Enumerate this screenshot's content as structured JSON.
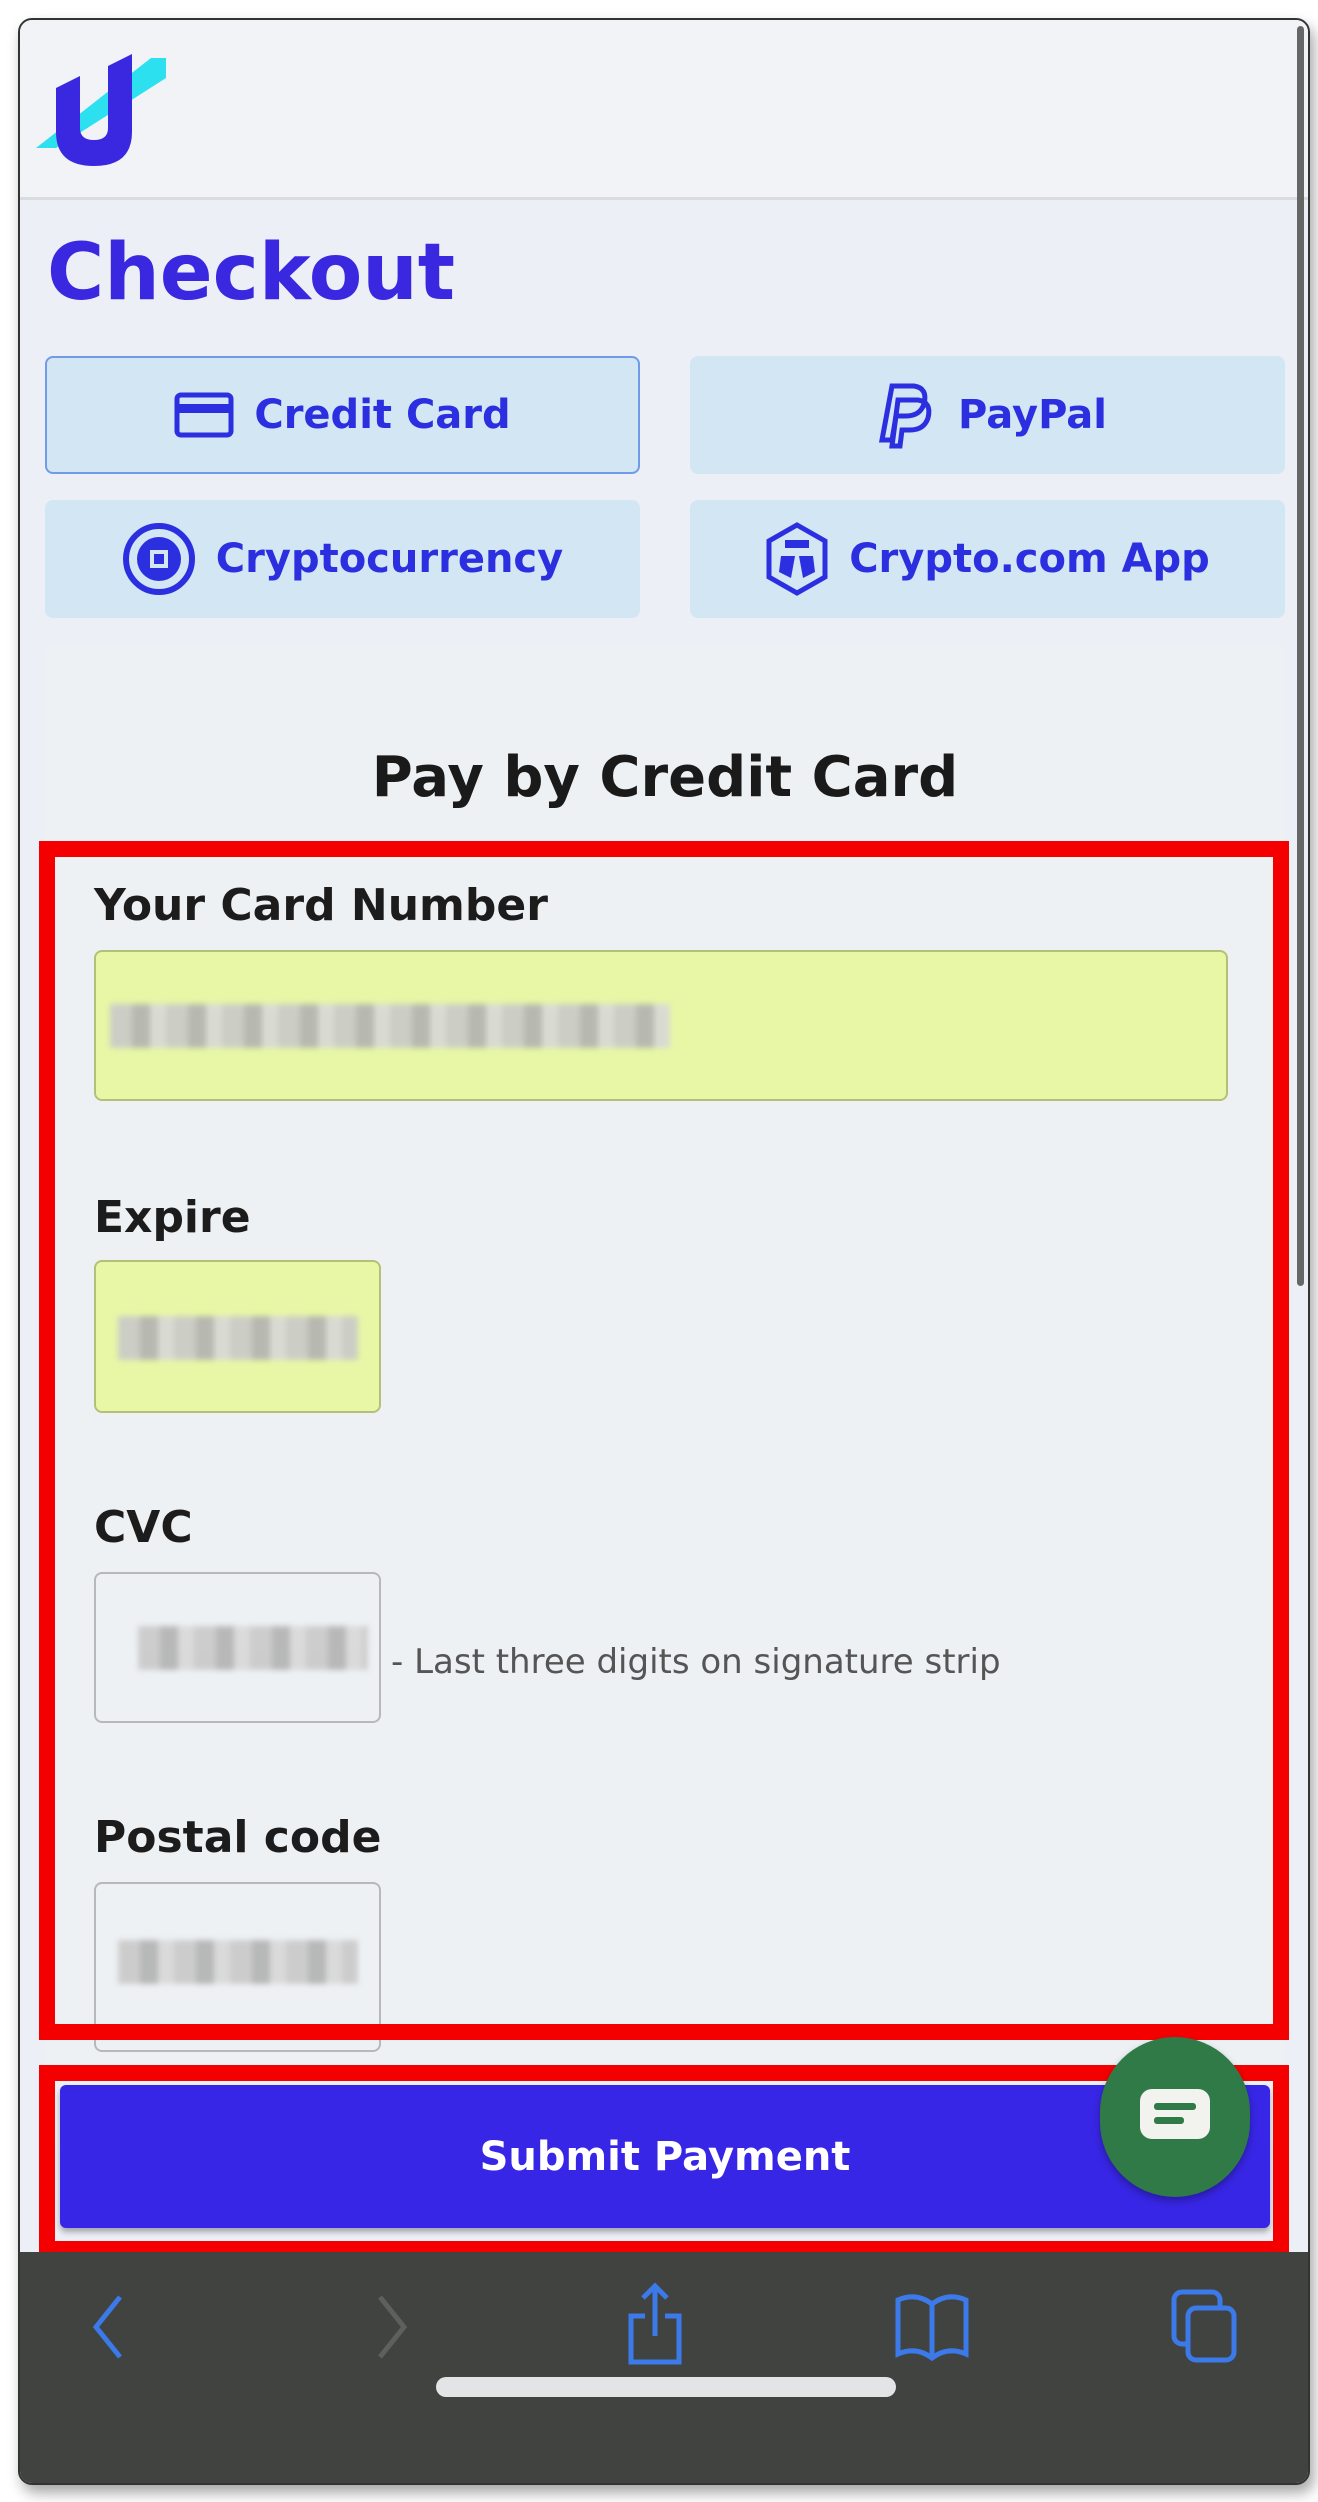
{
  "header": {
    "logo": "brand-logo"
  },
  "page": {
    "title": "Checkout"
  },
  "payment_methods": [
    {
      "label": "Credit Card",
      "icon": "credit-card-icon",
      "active": true
    },
    {
      "label": "PayPal",
      "icon": "paypal-icon",
      "active": false
    },
    {
      "label": "Cryptocurrency",
      "icon": "crypto-coin-icon",
      "active": false
    },
    {
      "label": "Crypto.com App",
      "icon": "crypto-com-icon",
      "active": false
    }
  ],
  "form": {
    "title": "Pay by Credit Card",
    "card_number_label": "Your Card Number",
    "expire_label": "Expire",
    "cvc_label": "CVC",
    "cvc_hint": "- Last three digits on signature strip",
    "postal_label": "Postal code",
    "submit_label": "Submit Payment"
  },
  "colors": {
    "accent": "#3826e6",
    "highlight": "#f50000",
    "autofill": "#e8f7a6",
    "chat": "#2f7a47",
    "toolbar_icon": "#3b7ae8"
  }
}
